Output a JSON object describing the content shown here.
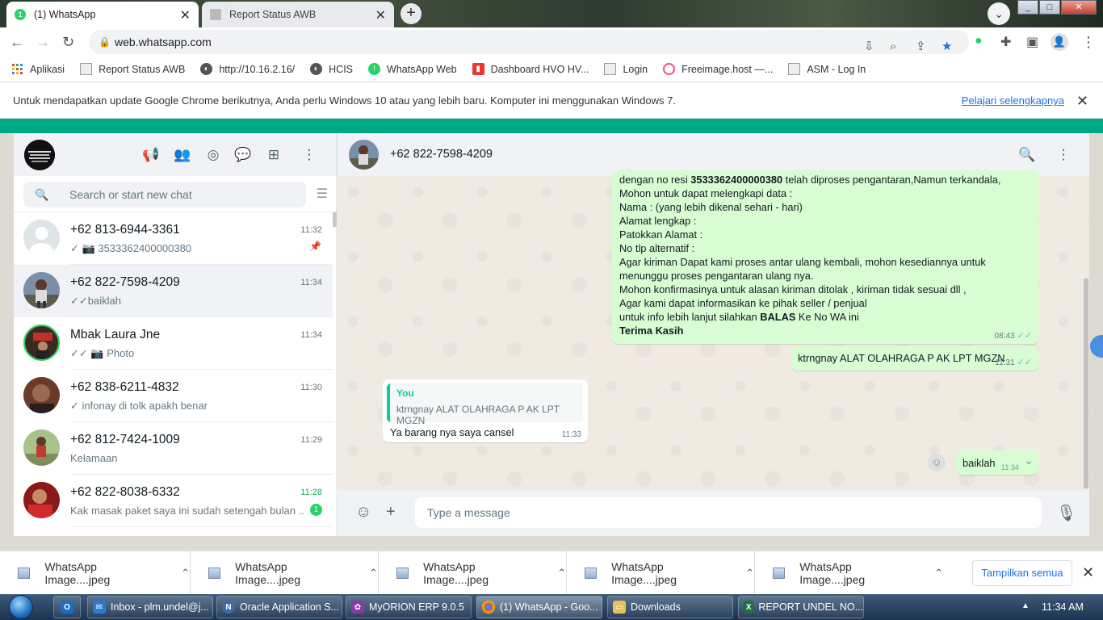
{
  "browser": {
    "tabs": [
      {
        "title": "(1) WhatsApp",
        "active": true
      },
      {
        "title": "Report Status AWB",
        "active": false
      }
    ],
    "url": "web.whatsapp.com",
    "bookmarks": [
      {
        "label": "Aplikasi",
        "icon": "apps-grid-icon"
      },
      {
        "label": "Report Status AWB",
        "icon": "page-icon"
      },
      {
        "label": "http://10.16.2.16/",
        "icon": "globe-icon"
      },
      {
        "label": "HCIS",
        "icon": "globe-icon"
      },
      {
        "label": "WhatsApp Web",
        "icon": "whatsapp-icon"
      },
      {
        "label": "Dashboard HVO HV...",
        "icon": "pdf-icon"
      },
      {
        "label": "Login",
        "icon": "page-icon"
      },
      {
        "label": "Freeimage.host —...",
        "icon": "freeimage-icon"
      },
      {
        "label": "ASM - Log In",
        "icon": "page-icon"
      }
    ],
    "infobar": {
      "message": "Untuk mendapatkan update Google Chrome berikutnya, Anda perlu Windows 10 atau yang lebih baru. Komputer ini menggunakan Windows 7.",
      "link": "Pelajari selengkapnya"
    }
  },
  "sidebar": {
    "search_placeholder": "Search or start new chat",
    "chats": [
      {
        "name": "+62 813-6944-3361",
        "time": "11:32",
        "status": "✓",
        "last": "3533362400000380",
        "has_camera": true,
        "pinned": true
      },
      {
        "name": "+62 822-7598-4209",
        "time": "11:34",
        "status": "✓✓",
        "last": "baiklah",
        "selected": true
      },
      {
        "name": "Mbak Laura Jne",
        "time": "11:34",
        "status": "✓✓",
        "last": "Photo",
        "has_camera": true
      },
      {
        "name": "+62 838-6211-4832",
        "time": "11:30",
        "status": "✓",
        "last": "infonay di tolk apakh benar"
      },
      {
        "name": "+62 812-7424-1009",
        "time": "11:29",
        "status": "",
        "last": "Kelamaan"
      },
      {
        "name": "+62 822-8038-6332",
        "time": "11:28",
        "status": "",
        "last": "Kak masak paket saya ini sudah setengah bulan ...",
        "unread": "1"
      }
    ]
  },
  "conversation": {
    "contact": "+62 822-7598-4209",
    "long_message": {
      "lines": [
        {
          "pre": "dengan no resi ",
          "bold": "3533362400000380",
          "post": " telah diproses pengantaran,Namun terkandala,"
        },
        {
          "pre": "Mohon untuk dapat melengkapi data :"
        },
        {
          "pre": "Nama : (yang lebih dikenal sehari - hari)"
        },
        {
          "pre": "Alamat  lengkap :"
        },
        {
          "pre": "Patokkan Alamat :"
        },
        {
          "pre": "No tlp alternatif :"
        },
        {
          "pre": "Agar kiriman Dapat kami proses antar ulang kembali, mohon kesediannya untuk"
        },
        {
          "pre": "menunggu proses pengantaran ulang nya."
        },
        {
          "pre": "Mohon konfirmasinya untuk alasan kiriman ditolak , kiriman tidak sesuai dll ,"
        },
        {
          "pre": "Agar kami dapat informasikan ke pihak seller / penjual"
        },
        {
          "pre": "untuk info lebih lanjut silahkan ",
          "bold": "BALAS",
          "post": " Ke No WA ini"
        },
        {
          "bold": "Terima Kasih"
        }
      ],
      "time": "08:43"
    },
    "msg_out_1": {
      "text": "ktrngnay ALAT OLAHRAGA P AK LPT MGZN",
      "time": "11:31"
    },
    "msg_in_1": {
      "quote_author": "You",
      "quote_text": "ktrngnay ALAT OLAHRAGA P AK LPT MGZN",
      "text": "Ya barang nya saya cansel",
      "time": "11:33"
    },
    "msg_out_2": {
      "text": "baiklah",
      "time": "11:34"
    },
    "composer_placeholder": "Type a message"
  },
  "downloads": {
    "items": [
      "WhatsApp Image....jpeg",
      "WhatsApp Image....jpeg",
      "WhatsApp Image....jpeg",
      "WhatsApp Image....jpeg",
      "WhatsApp Image....jpeg"
    ],
    "show_all": "Tampilkan semua"
  },
  "taskbar": {
    "items": [
      {
        "label": "Inbox - plm.undel@j..."
      },
      {
        "label": "Oracle Application S..."
      },
      {
        "label": "MyORION ERP 9.0.5"
      },
      {
        "label": "(1) WhatsApp - Goo..."
      },
      {
        "label": "Downloads"
      },
      {
        "label": "REPORT UNDEL NO..."
      }
    ],
    "clock": "11:34 AM"
  },
  "colors": {
    "whatsapp_green": "#00a884",
    "outgoing_bubble": "#d9fdd3",
    "read_tick": "#53bdeb",
    "chat_bg": "#efeae2"
  }
}
